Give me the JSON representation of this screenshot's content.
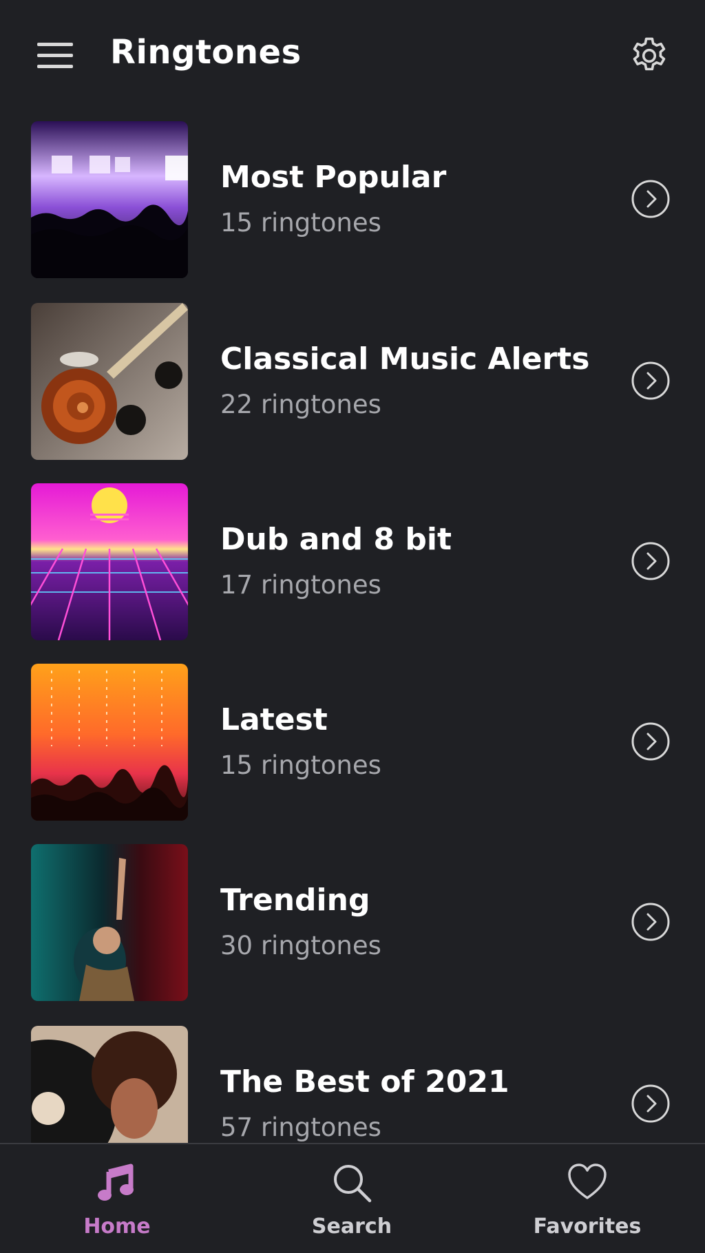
{
  "header": {
    "title": "Ringtones",
    "menu_icon": "hamburger-menu-icon",
    "settings_icon": "gear-icon"
  },
  "categories": [
    {
      "title": "Most Popular",
      "count": "15 ringtones",
      "image": "concert-stage-purple-lights"
    },
    {
      "title": "Classical Music Alerts",
      "count": "22 ringtones",
      "image": "violin-scroll"
    },
    {
      "title": "Dub and 8 bit",
      "count": "17 ringtones",
      "image": "retro-synthwave-grid"
    },
    {
      "title": "Latest",
      "count": "15 ringtones",
      "image": "crowd-orange-sunset-stage"
    },
    {
      "title": "Trending",
      "count": "30 ringtones",
      "image": "singer-arm-raised-teal-red"
    },
    {
      "title": "The Best of 2021",
      "count": "57 ringtones",
      "image": "woman-curly-hair-vinyl"
    }
  ],
  "bottom_nav": {
    "home": {
      "label": "Home",
      "icon": "music-note-icon",
      "active": true
    },
    "search": {
      "label": "Search",
      "icon": "search-icon",
      "active": false
    },
    "favorites": {
      "label": "Favorites",
      "icon": "heart-icon",
      "active": false
    }
  },
  "colors": {
    "background": "#1f2024",
    "accent": "#c77bc9",
    "subtitle": "#a7a8ad"
  }
}
